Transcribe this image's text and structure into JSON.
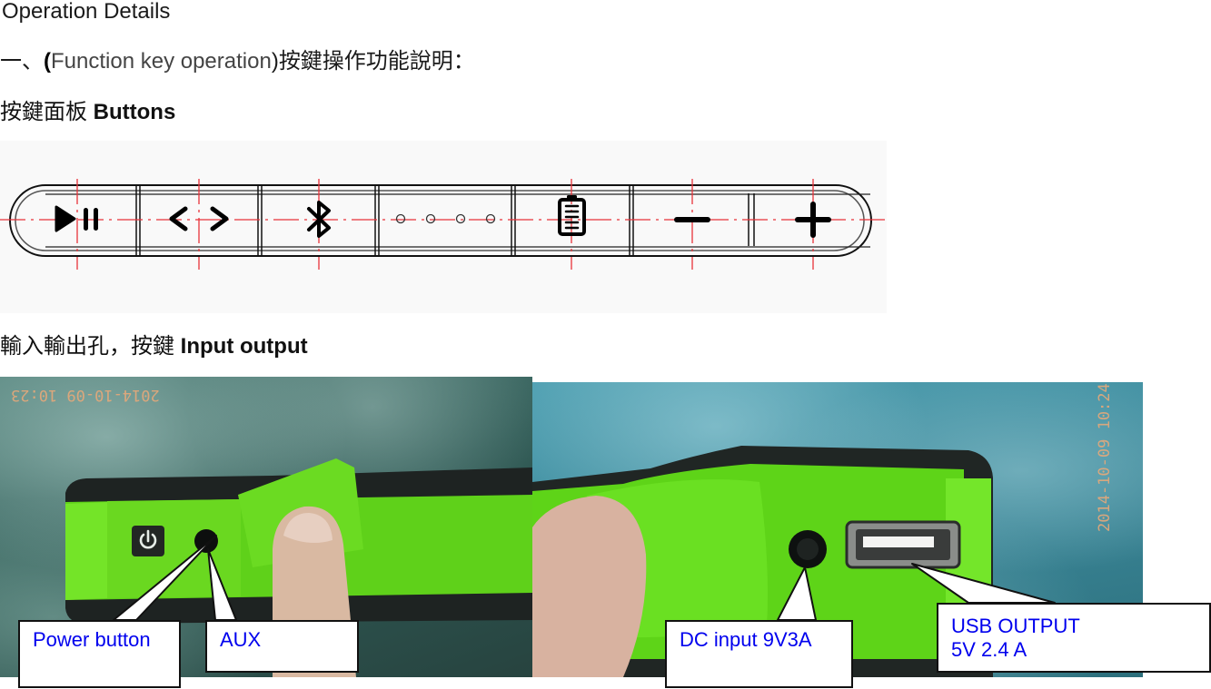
{
  "document": {
    "title": "Operation Details",
    "section_one": {
      "prefix": "一、",
      "paren_open": "(",
      "english": "Function key operation",
      "paren_close": ")",
      "chinese": "按鍵操作功能說明："
    },
    "buttons_heading": {
      "chinese": "按鍵面板 ",
      "english": "Buttons"
    },
    "io_heading": {
      "chinese": "輸入輸出孔，按鍵 ",
      "english": "Input output"
    }
  },
  "button_panel": {
    "buttons": [
      {
        "name": "play-pause",
        "icon": "play-pause-icon"
      },
      {
        "name": "previous-next",
        "icon": "prev-next-icon"
      },
      {
        "name": "bluetooth",
        "icon": "bluetooth-icon"
      },
      {
        "name": "indicator-leds",
        "icon": "led-dots-icon"
      },
      {
        "name": "battery",
        "icon": "battery-icon"
      },
      {
        "name": "volume-down",
        "icon": "minus-icon"
      },
      {
        "name": "volume-up",
        "icon": "plus-icon"
      }
    ],
    "colors": {
      "guide_line": "#e8333a",
      "outline": "#111111",
      "background": "#f9f9f9"
    }
  },
  "photos": {
    "left": {
      "timestamp": "2014-10-09 10:23"
    },
    "right": {
      "timestamp": "2014-10-09 10:24"
    }
  },
  "callouts": {
    "power": "Power button",
    "aux": "AUX",
    "dc": "DC input 9V3A",
    "usb_line1": "USB OUTPUT",
    "usb_line2": "5V 2.4 A",
    "text_color": "#0000ee"
  }
}
